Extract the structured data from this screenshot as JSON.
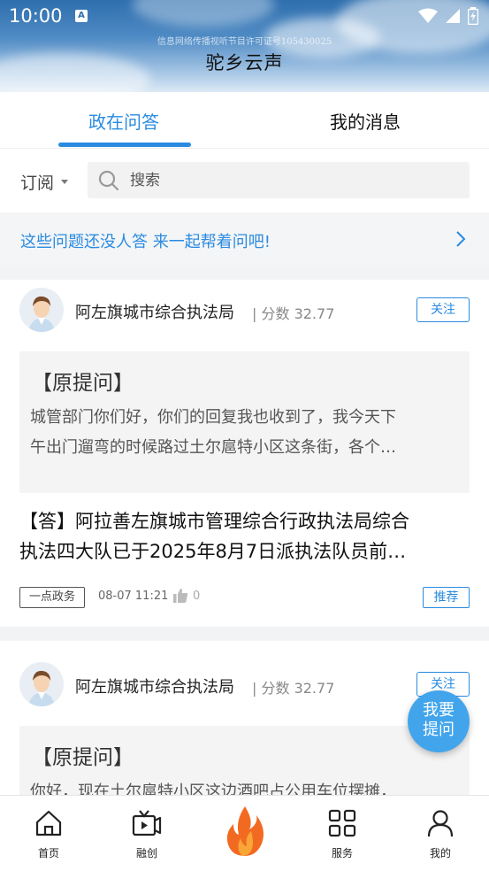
{
  "status_bar": {
    "time": "10:00",
    "notification_badge": "A"
  },
  "header": {
    "license": "信息网络传播视听节目许可证号105430025",
    "title": "驼乡云声"
  },
  "tabs": [
    {
      "label": "政在问答",
      "active": true
    },
    {
      "label": "我的消息",
      "active": false
    }
  ],
  "filter": {
    "subscribe_label": "订阅"
  },
  "search": {
    "placeholder": "搜索"
  },
  "banner": {
    "text": "这些问题还没人答 来一起帮着问吧!"
  },
  "cards": [
    {
      "org": "阿左旗城市综合执法局",
      "score": "| 分数 32.77",
      "follow_label": "关注",
      "question_title": "【原提问】",
      "question_lines": [
        "城管部门你们好，你们的回复我也收到了，我今天下",
        "午出门遛弯的时候路过土尔扈特小区这条街，各个…"
      ],
      "answer_lines": [
        "【答】阿拉善左旗城市管理综合行政执法局综合",
        "执法四大队已于2025年8月7日派执法队员前…"
      ],
      "source": "一点政务",
      "date": "08-07 11:21",
      "likes": "0",
      "recommend_label": "推荐"
    },
    {
      "org": "阿左旗城市综合执法局",
      "score": "| 分数 32.77",
      "follow_label": "关注",
      "question_title": "【原提问】",
      "question_lines": [
        "你好，现在土尔扈特小区这边酒吧占公用车位摆摊，"
      ]
    }
  ],
  "ask_button": {
    "line1": "我要",
    "line2": "提问"
  },
  "bottom_nav": [
    {
      "label": "首页",
      "icon": "home-icon"
    },
    {
      "label": "融创",
      "icon": "tv-play-icon"
    },
    {
      "label": "",
      "icon": "flame-icon"
    },
    {
      "label": "服务",
      "icon": "grid-icon"
    },
    {
      "label": "我的",
      "icon": "user-icon"
    }
  ],
  "colors": {
    "accent": "#2a8be0",
    "fab": "#42a5ec",
    "flame": "#f26a21"
  }
}
